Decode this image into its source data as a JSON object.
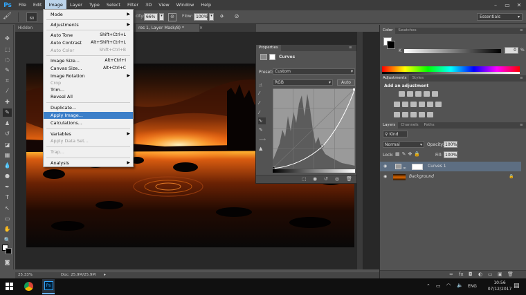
{
  "menubar": {
    "logo": "Ps",
    "items": [
      "File",
      "Edit",
      "Image",
      "Layer",
      "Type",
      "Select",
      "Filter",
      "3D",
      "View",
      "Window",
      "Help"
    ],
    "active": "Image"
  },
  "options": {
    "size": "60",
    "opacity_label": "city:",
    "opacity_value": "66%",
    "flow_label": "Flow:",
    "flow_value": "100%",
    "workspace": "Essentials"
  },
  "doc_tabs": {
    "tab1": "Hidden Exp",
    "tab2": "res 1, Layer Mask/8) *"
  },
  "image_menu": {
    "items": [
      {
        "label": "Mode",
        "shortcut": "",
        "submenu": true,
        "disabled": false
      },
      {
        "label": "Adjustments",
        "shortcut": "",
        "submenu": true,
        "disabled": false
      },
      {
        "label": "Auto Tone",
        "shortcut": "Shift+Ctrl+L",
        "submenu": false,
        "disabled": false
      },
      {
        "label": "Auto Contrast",
        "shortcut": "Alt+Shift+Ctrl+L",
        "submenu": false,
        "disabled": false
      },
      {
        "label": "Auto Color",
        "shortcut": "Shift+Ctrl+B",
        "submenu": false,
        "disabled": true
      },
      {
        "label": "Image Size...",
        "shortcut": "Alt+Ctrl+I",
        "submenu": false,
        "disabled": false
      },
      {
        "label": "Canvas Size...",
        "shortcut": "Alt+Ctrl+C",
        "submenu": false,
        "disabled": false
      },
      {
        "label": "Image Rotation",
        "shortcut": "",
        "submenu": true,
        "disabled": false
      },
      {
        "label": "Crop",
        "shortcut": "",
        "submenu": false,
        "disabled": true
      },
      {
        "label": "Trim...",
        "shortcut": "",
        "submenu": false,
        "disabled": false
      },
      {
        "label": "Reveal All",
        "shortcut": "",
        "submenu": false,
        "disabled": false
      },
      {
        "label": "Duplicate...",
        "shortcut": "",
        "submenu": false,
        "disabled": false
      },
      {
        "label": "Apply Image...",
        "shortcut": "",
        "submenu": false,
        "disabled": false,
        "selected": true
      },
      {
        "label": "Calculations...",
        "shortcut": "",
        "submenu": false,
        "disabled": false
      },
      {
        "label": "Variables",
        "shortcut": "",
        "submenu": true,
        "disabled": false
      },
      {
        "label": "Apply Data Set...",
        "shortcut": "",
        "submenu": false,
        "disabled": true
      },
      {
        "label": "Trap...",
        "shortcut": "",
        "submenu": false,
        "disabled": true
      },
      {
        "label": "Analysis",
        "shortcut": "",
        "submenu": true,
        "disabled": false
      }
    ]
  },
  "properties": {
    "tabs": [
      "Properties"
    ],
    "title": "Curves",
    "preset_label": "Preset:",
    "preset_value": "Custom",
    "channel": "RGB",
    "auto_button": "Auto"
  },
  "color_panel": {
    "tabs": [
      "Color",
      "Swatches"
    ],
    "k_label": "K",
    "k_value": "0",
    "k_unit": "%"
  },
  "adjustments_panel": {
    "tabs": [
      "Adjustments",
      "Styles"
    ],
    "heading": "Add an adjustment"
  },
  "layers_panel": {
    "tabs": [
      "Layers",
      "Channels",
      "Paths"
    ],
    "filter": "Kind",
    "blend_mode": "Normal",
    "opacity_label": "Opacity:",
    "opacity_value": "100%",
    "lock_label": "Lock:",
    "fill_label": "Fill:",
    "fill_value": "100%",
    "layers": [
      {
        "name": "Curves 1",
        "selected": true
      },
      {
        "name": "Background",
        "selected": false
      }
    ]
  },
  "status": {
    "zoom": "25.33%",
    "doc": "Doc: 25.9M/25.9M"
  },
  "taskbar": {
    "lang": "ENG",
    "time": "10:56",
    "date": "07/12/2017"
  }
}
